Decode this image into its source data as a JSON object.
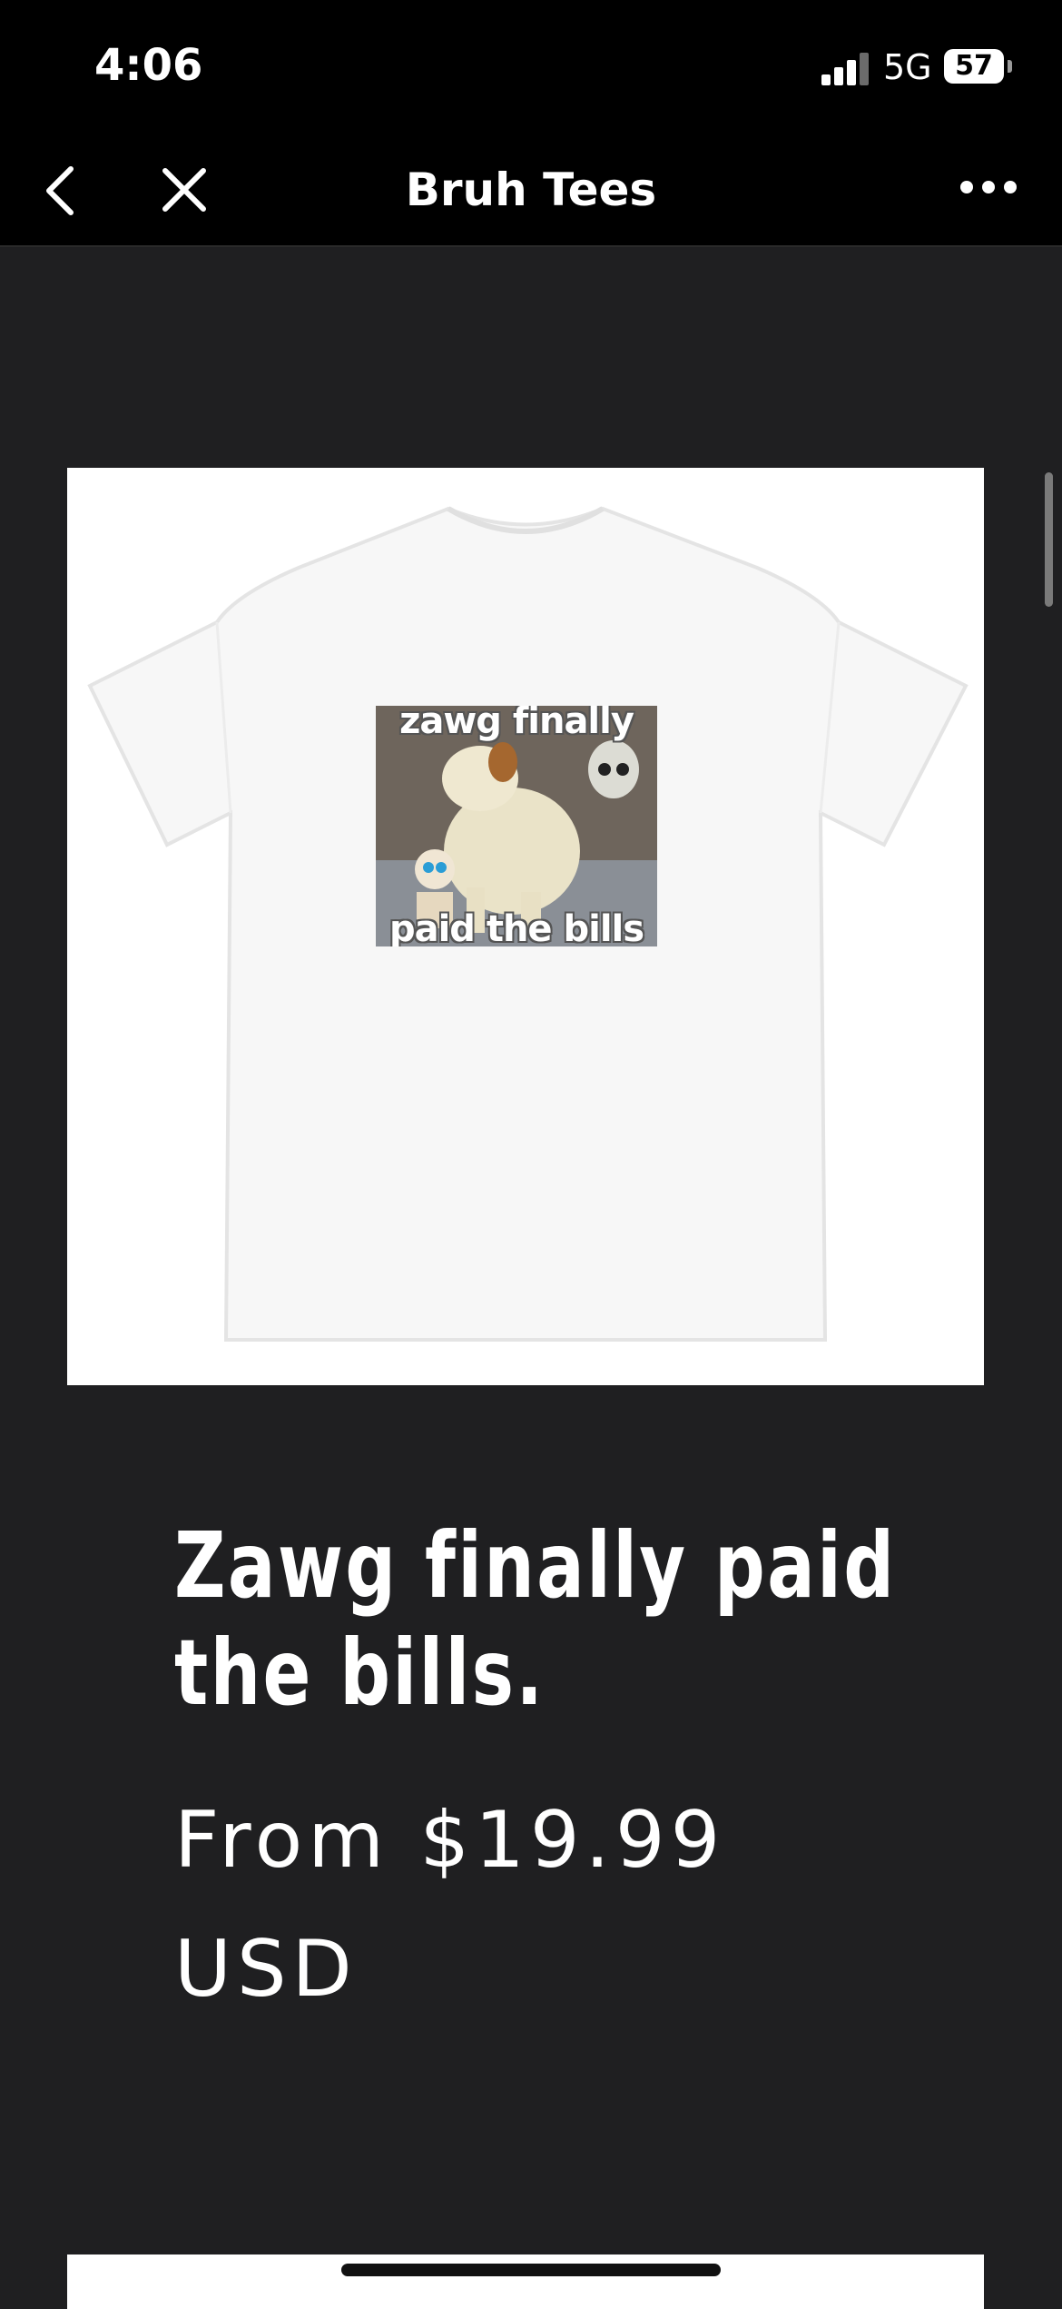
{
  "status_bar": {
    "time": "4:06",
    "network": "5G",
    "battery": "57"
  },
  "nav": {
    "title": "Bruh Tees",
    "back_icon": "chevron-left-icon",
    "close_icon": "close-icon",
    "more_icon": "more-horizontal-icon"
  },
  "product": {
    "image_caption_top": "zawg finally",
    "image_caption_bottom": "paid the bills",
    "title": "Zawg finally paid the bills.",
    "price": "From $19.99 USD"
  },
  "colors": {
    "background": "#1f1f21",
    "bar": "#000000",
    "text": "#ffffff"
  }
}
